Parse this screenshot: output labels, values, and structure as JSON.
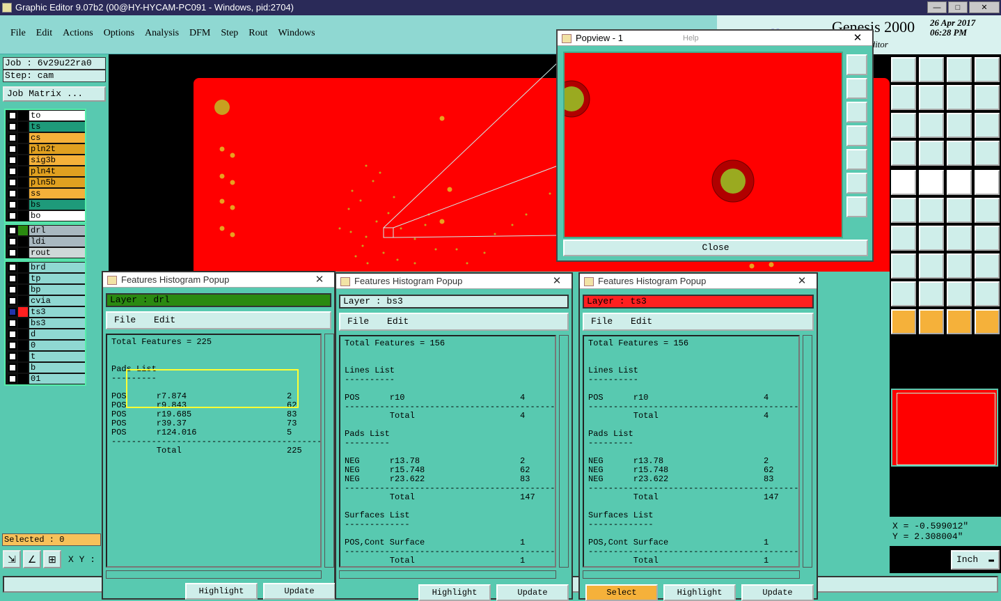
{
  "window": {
    "title": "Graphic Editor 9.07b2 (00@HY-HYCAM-PC091 - Windows, pid:2704)"
  },
  "menu": [
    "File",
    "Edit",
    "Actions",
    "Options",
    "Analysis",
    "DFM",
    "Step",
    "Rout",
    "Windows"
  ],
  "brand": {
    "product": "Genesis 2000",
    "date_line1": "26 Apr 2017",
    "date_line2": "06:28 PM",
    "sub": "ic Editor",
    "logo": "Frontline"
  },
  "job": {
    "job": "Job : 6v29u22ra0",
    "step": "Step: cam",
    "matrix_button": "Job Matrix ..."
  },
  "layers_board": [
    {
      "name": "to",
      "color": "#ffffff"
    },
    {
      "name": "ts",
      "color": "#1e9a7a"
    },
    {
      "name": "cs",
      "color": "#f5b13a"
    },
    {
      "name": "pln2t",
      "color": "#e0a020"
    },
    {
      "name": "sig3b",
      "color": "#f5b13a"
    },
    {
      "name": "pln4t",
      "color": "#e0a020"
    },
    {
      "name": "pln5b",
      "color": "#e0a020"
    },
    {
      "name": "ss",
      "color": "#f5b13a"
    },
    {
      "name": "bs",
      "color": "#1e9a7a"
    },
    {
      "name": "bo",
      "color": "#ffffff"
    }
  ],
  "layers_drill": [
    {
      "name": "drl",
      "color": "#a8b8c0",
      "sw": "#2a8a10"
    },
    {
      "name": "ldi",
      "color": "#a8b8c0",
      "sw": "#000000"
    },
    {
      "name": "rout",
      "color": "#cfd8d8",
      "sw": "#000000"
    }
  ],
  "layers_misc": [
    {
      "name": "brd",
      "color": "#8fd8d2"
    },
    {
      "name": "tp",
      "color": "#8fd8d2"
    },
    {
      "name": "bp",
      "color": "#8fd8d2"
    },
    {
      "name": "cvia",
      "color": "#8fd8d2"
    },
    {
      "name": "ts3",
      "color": "#8fd8d2",
      "sw": "#ff2020",
      "active": true
    },
    {
      "name": "bs3",
      "color": "#8fd8d2"
    },
    {
      "name": "d",
      "color": "#8fd8d2"
    },
    {
      "name": "0",
      "color": "#8fd8d2"
    },
    {
      "name": "t",
      "color": "#8fd8d2"
    },
    {
      "name": "b",
      "color": "#8fd8d2"
    },
    {
      "name": "01",
      "color": "#8fd8d2"
    }
  ],
  "selected": "Selected : 0",
  "xy_label": "X Y :",
  "popview": {
    "title": "Popview - 1",
    "close": "Close",
    "help": "Help"
  },
  "coords": {
    "x": "X = -0.599012\"",
    "y": "Y = 2.308004\""
  },
  "units": "Inch",
  "histograms": [
    {
      "title": "Features Histogram Popup",
      "layer": "Layer :  drl",
      "layer_color": "#2a8a10",
      "menu": [
        "File",
        "Edit"
      ],
      "text": "Total Features = 225\n\n\nPads List\n---------\n\nPOS      r7.874                    2\nPOS      r9.843                    62\nPOS      r19.685                   83\nPOS      r39.37                    73\nPOS      r124.016                  5\n-------------------------------------------\n         Total                     225",
      "buttons": [
        "Highlight",
        "Update"
      ]
    },
    {
      "title": "Features Histogram Popup",
      "layer": "Layer :  bs3",
      "layer_color": "#cfeeea",
      "menu": [
        "File",
        "Edit"
      ],
      "text": "Total Features = 156\n\n\nLines List\n----------\n\nPOS      r10                       4\n-------------------------------------------\n         Total                     4\n\nPads List\n---------\n\nNEG      r13.78                    2\nNEG      r15.748                   62\nNEG      r23.622                   83\n-------------------------------------------\n         Total                     147\n\nSurfaces List\n-------------\n\nPOS,Cont Surface                   1\n-------------------------------------------\n         Total                     1",
      "buttons": [
        "Highlight",
        "Update"
      ]
    },
    {
      "title": "Features Histogram Popup",
      "layer": "Layer :  ts3",
      "layer_color": "#ff2020",
      "menu": [
        "File",
        "Edit"
      ],
      "text": "Total Features = 156\n\n\nLines List\n----------\n\nPOS      r10                       4\n-------------------------------------------\n         Total                     4\n\nPads List\n---------\n\nNEG      r13.78                    2\nNEG      r15.748                   62\nNEG      r23.622                   83\n-------------------------------------------\n         Total                     147\n\nSurfaces List\n-------------\n\nPOS,Cont Surface                   1\n-------------------------------------------\n         Total                     1",
      "buttons": [
        "Select",
        "Highlight",
        "Update"
      ]
    }
  ]
}
